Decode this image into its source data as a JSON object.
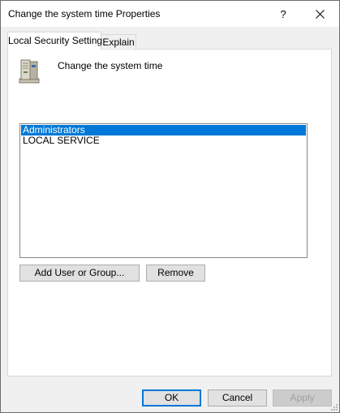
{
  "window": {
    "title": "Change the system time Properties",
    "help_glyph": "?",
    "close_icon": "close-icon"
  },
  "tabs": [
    {
      "label": "Local Security Setting",
      "active": true
    },
    {
      "label": "Explain",
      "active": false
    }
  ],
  "policy": {
    "icon": "server-computer-icon",
    "name": "Change the system time"
  },
  "accounts": {
    "items": [
      {
        "label": "Administrators",
        "selected": true
      },
      {
        "label": "LOCAL SERVICE",
        "selected": false
      }
    ]
  },
  "actions": {
    "add_label": "Add User or Group...",
    "remove_label": "Remove"
  },
  "footer": {
    "ok_label": "OK",
    "cancel_label": "Cancel",
    "apply_label": "Apply"
  },
  "colors": {
    "selection": "#0078d7",
    "window_bg": "#f0f0f0",
    "panel_bg": "#ffffff"
  }
}
